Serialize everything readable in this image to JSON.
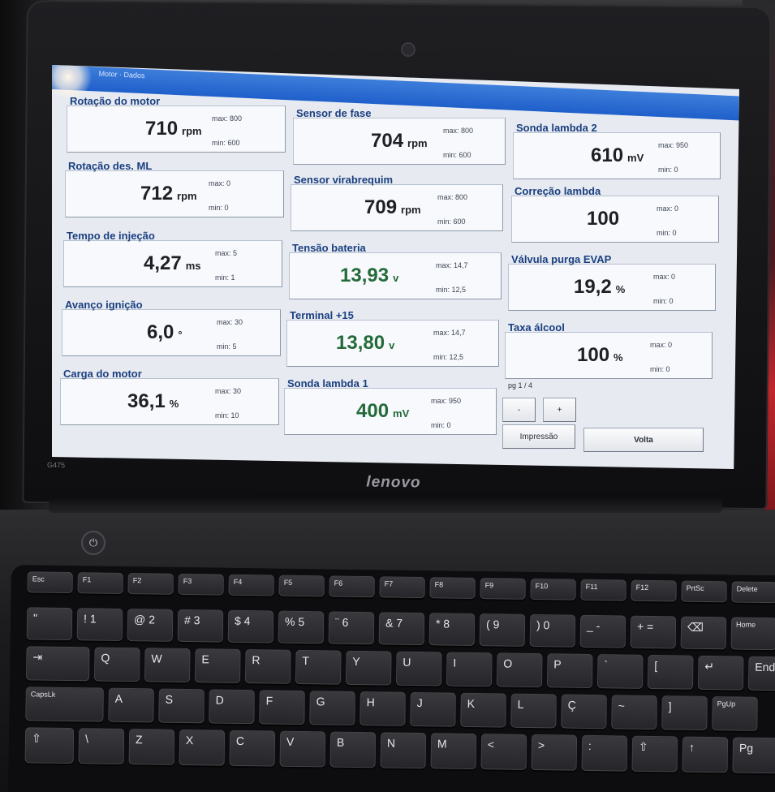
{
  "window_title": "Motor · Dados",
  "gauges": [
    {
      "id": "rotacao-motor",
      "title": "Rotação do motor",
      "value": "710",
      "unit": "rpm",
      "max": "max: 800",
      "min": "min: 600",
      "color": "dark"
    },
    {
      "id": "rotacao-des-ml",
      "title": "Rotação des. ML",
      "value": "712",
      "unit": "rpm",
      "max": "max: 0",
      "min": "min: 0",
      "color": "dark"
    },
    {
      "id": "tempo-injecao",
      "title": "Tempo de injeção",
      "value": "4,27",
      "unit": "ms",
      "max": "max: 5",
      "min": "min: 1",
      "color": "dark"
    },
    {
      "id": "avanco-ignicao",
      "title": "Avanço ignição",
      "value": "6,0",
      "unit": "°",
      "max": "max: 30",
      "min": "min: 5",
      "color": "dark"
    },
    {
      "id": "carga-motor",
      "title": "Carga do motor",
      "value": "36,1",
      "unit": "%",
      "max": "max: 30",
      "min": "min: 10",
      "color": "dark"
    },
    {
      "id": "sensor-fase",
      "title": "Sensor de fase",
      "value": "704",
      "unit": "rpm",
      "max": "max: 800",
      "min": "min: 600",
      "color": "dark"
    },
    {
      "id": "sensor-virabrequim",
      "title": "Sensor virabrequim",
      "value": "709",
      "unit": "rpm",
      "max": "max: 800",
      "min": "min: 600",
      "color": "dark"
    },
    {
      "id": "tensao-bateria",
      "title": "Tensão bateria",
      "value": "13,93",
      "unit": "v",
      "max": "max: 14,7",
      "min": "min: 12,5",
      "color": "green"
    },
    {
      "id": "terminal-15",
      "title": "Terminal +15",
      "value": "13,80",
      "unit": "v",
      "max": "max: 14,7",
      "min": "min: 12,5",
      "color": "green"
    },
    {
      "id": "sonda-lambda-1",
      "title": "Sonda lambda 1",
      "value": "400",
      "unit": "mV",
      "max": "max: 950",
      "min": "min: 0",
      "color": "green"
    },
    {
      "id": "sonda-lambda-2",
      "title": "Sonda lambda 2",
      "value": "610",
      "unit": "mV",
      "max": "max: 950",
      "min": "min: 0",
      "color": "dark"
    },
    {
      "id": "correcao-lambda",
      "title": "Correção lambda",
      "value": "100",
      "unit": "",
      "max": "max: 0",
      "min": "min: 0",
      "color": "dark"
    },
    {
      "id": "valvula-purga",
      "title": "Válvula purga EVAP",
      "value": "19,2",
      "unit": "%",
      "max": "max: 0",
      "min": "min: 0",
      "color": "dark"
    },
    {
      "id": "taxa-alcool",
      "title": "Taxa álcool",
      "value": "100",
      "unit": "%",
      "max": "max: 0",
      "min": "min: 0",
      "color": "dark"
    }
  ],
  "page_indicator": "pg 1 / 4",
  "buttons": {
    "prev": "-",
    "next": "+",
    "print": "Impressão",
    "back": "Volta"
  },
  "laptop": {
    "brand": "lenovo",
    "model": "G475"
  },
  "keyboard": {
    "rows": [
      [
        "Esc",
        "F1",
        "F2",
        "F3",
        "F4",
        "F5",
        "F6",
        "F7",
        "F8",
        "F9",
        "F10",
        "F11",
        "F12",
        "PrtSc",
        "Delete"
      ],
      [
        "\"",
        "! 1",
        "@ 2",
        "# 3",
        "$ 4",
        "% 5",
        "¨ 6",
        "& 7",
        "* 8",
        "( 9",
        ") 0",
        "_ -",
        "+ =",
        "⌫",
        "Home"
      ],
      [
        "⇥",
        "Q",
        "W",
        "E",
        "R",
        "T",
        "Y",
        "U",
        "I",
        "O",
        "P",
        "`",
        "[",
        "↵",
        "End"
      ],
      [
        "CapsLk",
        "A",
        "S",
        "D",
        "F",
        "G",
        "H",
        "J",
        "K",
        "L",
        "Ç",
        "~",
        "]",
        "PgUp"
      ],
      [
        "⇧",
        "\\",
        "Z",
        "X",
        "C",
        "V",
        "B",
        "N",
        "M",
        "<",
        ">",
        ":",
        "⇧",
        "↑",
        "Pg"
      ]
    ]
  }
}
